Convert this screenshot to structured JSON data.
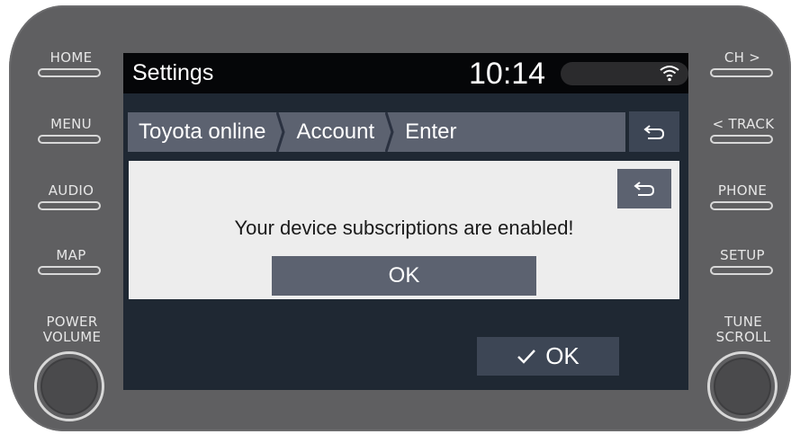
{
  "hardware": {
    "left_buttons": [
      "HOME",
      "MENU",
      "AUDIO",
      "MAP"
    ],
    "right_buttons": [
      "CH >",
      "< TRACK",
      "PHONE",
      "SETUP"
    ],
    "left_knob_label": [
      "POWER",
      "VOLUME"
    ],
    "right_knob_label": [
      "TUNE",
      "SCROLL"
    ]
  },
  "status": {
    "title": "Settings",
    "time": "10:14",
    "wifi_icon": "wifi-icon"
  },
  "breadcrumb": {
    "items": [
      "Toyota online",
      "Account",
      "Enter"
    ],
    "back_icon": "back-arrow-icon"
  },
  "dialog": {
    "message": "Your device subscriptions are enabled!",
    "ok_label": "OK",
    "back_icon": "back-arrow-icon"
  },
  "footer": {
    "confirm_label": "OK",
    "check_icon": "checkmark-icon"
  },
  "colors": {
    "bezel": "#5f5f61",
    "screen_bg": "#1f2833",
    "button_dark": "#3d4655",
    "button_mid": "#5c6270",
    "dialog_bg": "#ededed"
  }
}
